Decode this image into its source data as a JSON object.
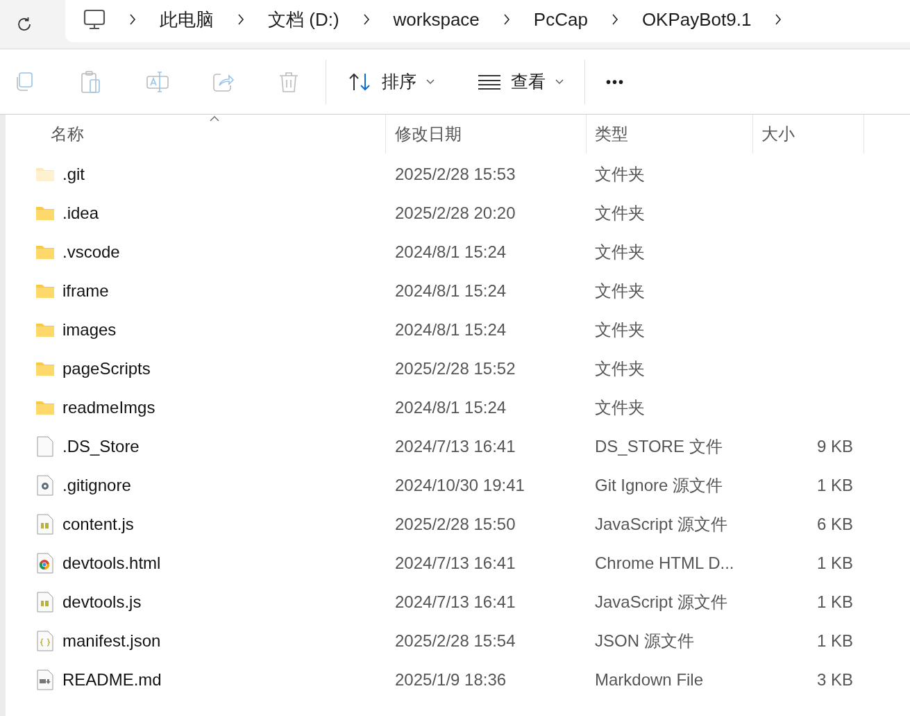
{
  "breadcrumb": [
    "此电脑",
    "文档 (D:)",
    "workspace",
    "PcCap",
    "OKPayBot9.1"
  ],
  "toolbar": {
    "sort": "排序",
    "view": "查看",
    "more": "•••"
  },
  "columns": [
    "名称",
    "修改日期",
    "类型",
    "大小"
  ],
  "files": [
    {
      "name": ".git",
      "date": "2025/2/28 15:53",
      "type": "文件夹",
      "kind": "folder",
      "hidden": true
    },
    {
      "name": ".idea",
      "date": "2025/2/28 20:20",
      "type": "文件夹",
      "kind": "folder",
      "hidden": false
    },
    {
      "name": ".vscode",
      "date": "2024/8/1 15:24",
      "type": "文件夹",
      "kind": "folder",
      "hidden": false
    },
    {
      "name": "iframe",
      "date": "2024/8/1 15:24",
      "type": "文件夹",
      "kind": "folder",
      "hidden": false
    },
    {
      "name": "images",
      "date": "2024/8/1 15:24",
      "type": "文件夹",
      "kind": "folder",
      "hidden": false
    },
    {
      "name": "pageScripts",
      "date": "2025/2/28 15:52",
      "type": "文件夹",
      "kind": "folder",
      "hidden": false
    },
    {
      "name": "readmeImgs",
      "date": "2024/8/1 15:24",
      "type": "文件夹",
      "kind": "folder",
      "hidden": false
    },
    {
      "name": ".DS_Store",
      "date": "2024/7/13 16:41",
      "type": "DS_STORE 文件",
      "size": "9 KB",
      "kind": "blank"
    },
    {
      "name": ".gitignore",
      "date": "2024/10/30 19:41",
      "type": "Git Ignore 源文件",
      "size": "1 KB",
      "kind": "config"
    },
    {
      "name": "content.js",
      "date": "2025/2/28 15:50",
      "type": "JavaScript 源文件",
      "size": "6 KB",
      "kind": "script"
    },
    {
      "name": "devtools.html",
      "date": "2024/7/13 16:41",
      "type": "Chrome HTML D...",
      "size": "1 KB",
      "kind": "web"
    },
    {
      "name": "devtools.js",
      "date": "2024/7/13 16:41",
      "type": "JavaScript 源文件",
      "size": "1 KB",
      "kind": "script"
    },
    {
      "name": "manifest.json",
      "date": "2025/2/28 15:54",
      "type": "JSON 源文件",
      "size": "1 KB",
      "kind": "json"
    },
    {
      "name": "README.md",
      "date": "2025/1/9 18:36",
      "type": "Markdown File",
      "size": "3 KB",
      "kind": "markdown"
    }
  ]
}
